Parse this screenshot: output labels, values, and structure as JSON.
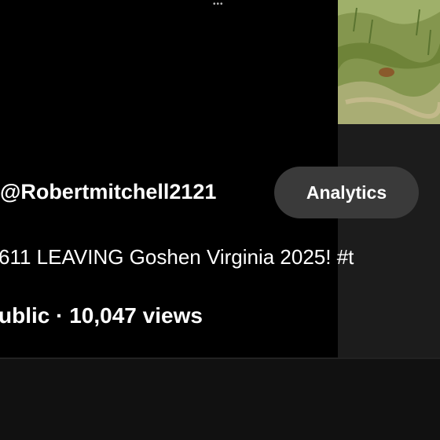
{
  "header": {
    "more_icon": "more-horizontal-icon",
    "more_glyph": "•••"
  },
  "channel": {
    "handle": "@Robertmitchell2121"
  },
  "actions": {
    "analytics_label": "Analytics"
  },
  "video": {
    "title": "611  LEAVING Goshen Virginia 2025! #t",
    "meta": "ublic · 10,047 views",
    "thumbnail": "grass-field-thumbnail"
  },
  "colors": {
    "background": "#000000",
    "button_bg": "#3a3a3a",
    "side_panel": "#1c1c1c",
    "bottom_area": "#111111"
  }
}
